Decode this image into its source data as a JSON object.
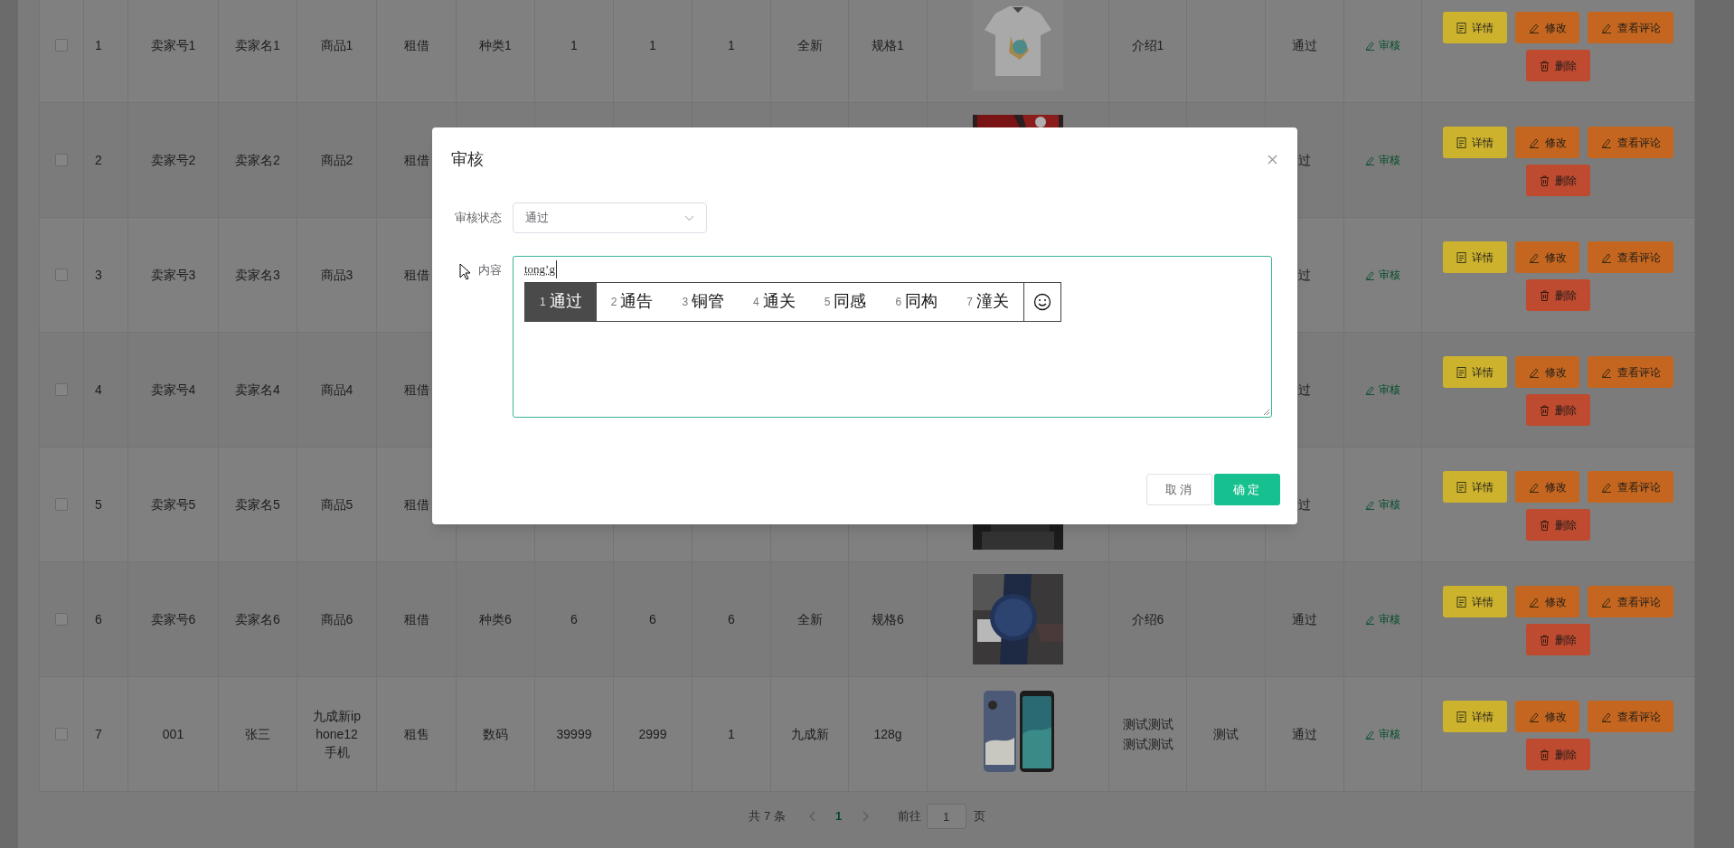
{
  "table": {
    "rows": [
      {
        "checked": false,
        "index": "1",
        "seller_id": "卖家号1",
        "seller_name": "卖家名1",
        "product": "商品1",
        "mode": "租借",
        "category": "种类1",
        "column_7": "1",
        "column_8": "1",
        "column_9": "1",
        "condition": "全新",
        "spec": "规格1",
        "image": {
          "kind": "picture"
        },
        "intro": [
          "介绍1"
        ],
        "status": "通过",
        "review_link": "审核",
        "actions": [
          {
            "label": "详情",
            "kind": "detail"
          },
          {
            "label": "修改",
            "kind": "edit"
          },
          {
            "label": "查看评论",
            "kind": "comments"
          },
          {
            "label": "删除",
            "kind": "delete"
          }
        ]
      },
      {
        "checked": false,
        "index": "2",
        "seller_id": "卖家号2",
        "seller_name": "卖家名2",
        "product": "商品2",
        "mode": "租借",
        "image": {
          "kind": "picture"
        },
        "status": "过",
        "review_link": "审核",
        "actions": [
          {
            "label": "详情",
            "kind": "detail"
          },
          {
            "label": "修改",
            "kind": "edit"
          },
          {
            "label": "查看评论",
            "kind": "comments"
          },
          {
            "label": "删除",
            "kind": "delete"
          }
        ]
      },
      {
        "checked": false,
        "index": "3",
        "seller_id": "卖家号3",
        "seller_name": "卖家名3",
        "product": "商品3",
        "mode": "租借",
        "status": "过",
        "review_link": "审核",
        "actions": [
          {
            "label": "详情",
            "kind": "detail"
          },
          {
            "label": "修改",
            "kind": "edit"
          },
          {
            "label": "查看评论",
            "kind": "comments"
          },
          {
            "label": "删除",
            "kind": "delete"
          }
        ]
      },
      {
        "checked": false,
        "index": "4",
        "seller_id": "卖家号4",
        "seller_name": "卖家名4",
        "product": "商品4",
        "mode": "租借",
        "status": "过",
        "review_link": "审核",
        "actions": [
          {
            "label": "详情",
            "kind": "detail"
          },
          {
            "label": "修改",
            "kind": "edit"
          },
          {
            "label": "查看评论",
            "kind": "comments"
          },
          {
            "label": "删除",
            "kind": "delete"
          }
        ]
      },
      {
        "checked": false,
        "index": "5",
        "seller_id": "卖家号5",
        "seller_name": "卖家名5",
        "product": "商品5",
        "mode": "租借",
        "image": {
          "kind": "picture"
        },
        "status": "过",
        "review_link": "审核",
        "actions": [
          {
            "label": "详情",
            "kind": "detail"
          },
          {
            "label": "修改",
            "kind": "edit"
          },
          {
            "label": "查看评论",
            "kind": "comments"
          },
          {
            "label": "删除",
            "kind": "delete"
          }
        ]
      },
      {
        "checked": false,
        "index": "6",
        "seller_id": "卖家号6",
        "seller_name": "卖家名6",
        "product": "商品6",
        "mode": "租借",
        "category": "种类6",
        "column_7": "6",
        "column_8": "6",
        "column_9": "6",
        "condition": "全新",
        "spec": "规格6",
        "image": {
          "kind": "picture"
        },
        "intro": [
          "介绍6"
        ],
        "status": "通过",
        "review_link": "审核",
        "actions": [
          {
            "label": "详情",
            "kind": "detail"
          },
          {
            "label": "修改",
            "kind": "edit"
          },
          {
            "label": "查看评论",
            "kind": "comments"
          },
          {
            "label": "删除",
            "kind": "delete"
          }
        ]
      },
      {
        "checked": false,
        "index": "7",
        "seller_id": "001",
        "seller_name": "张三",
        "product": "九成新iphone12手机",
        "mode": "租售",
        "category": "数码",
        "column_7": "39999",
        "column_8": "2999",
        "column_9": "1",
        "condition": "九成新",
        "spec": "128g",
        "image": {
          "kind": "picture"
        },
        "intro": [
          "测试测试",
          "测试测试"
        ],
        "column_15": "测试",
        "status": "通过",
        "review_link": "审核",
        "actions": [
          {
            "label": "详情",
            "kind": "detail"
          },
          {
            "label": "修改",
            "kind": "edit"
          },
          {
            "label": "查看评论",
            "kind": "comments"
          },
          {
            "label": "删除",
            "kind": "delete"
          }
        ]
      }
    ]
  },
  "pagination": {
    "total": "共 7 条",
    "pages": [
      {
        "label": "1",
        "selected": true
      }
    ],
    "goto_label": "前往",
    "goto_value": "1",
    "page_suffix": "页"
  },
  "dialog": {
    "title": "审核",
    "fields": [
      {
        "kind": "select",
        "label": "审核状态",
        "value": "通过"
      },
      {
        "kind": "textarea",
        "label": "内容",
        "value": "tong’g"
      }
    ],
    "ime_candidates": [
      {
        "number": "1",
        "text": "通过",
        "selected": true
      },
      {
        "number": "2",
        "text": "通告",
        "selected": false
      },
      {
        "number": "3",
        "text": "铜管",
        "selected": false
      },
      {
        "number": "4",
        "text": "通关",
        "selected": false
      },
      {
        "number": "5",
        "text": "同感",
        "selected": false
      },
      {
        "number": "6",
        "text": "同构",
        "selected": false
      },
      {
        "number": "7",
        "text": "潼关",
        "selected": false
      }
    ],
    "buttons": [
      {
        "label": "取消",
        "kind": "default"
      },
      {
        "label": "确定",
        "kind": "primary"
      }
    ]
  }
}
